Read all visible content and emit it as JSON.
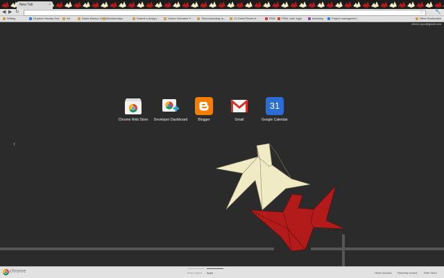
{
  "window": {
    "tab_title": "New Tab",
    "tab_close": "×",
    "back": "◀",
    "forward": "▶",
    "reload": "↻",
    "star": "☆",
    "wrench": "🔧",
    "user_email": "eileen.l.guo@gmail.com"
  },
  "bookmarks": {
    "items": [
      {
        "label": "Writing",
        "color": "#caa23a"
      },
      {
        "label": "Dropbox Nearby Scri...",
        "color": "#2a7de1"
      },
      {
        "label": "Art",
        "color": "#c9a43b"
      },
      {
        "label": "Santa Monica Grant...",
        "color": "#c9a43b"
      },
      {
        "label": "Scholarships",
        "color": "#c9a43b"
      },
      {
        "label": "Submit a design...",
        "color": "#c9a43b"
      },
      {
        "label": "Online Volunteer F...",
        "color": "#c9a43b"
      },
      {
        "label": "Telecommuting Jo...",
        "color": "#c9a43b"
      },
      {
        "label": "10 Great Places fr...",
        "color": "#c9a43b"
      },
      {
        "label": "PDM",
        "color": "#d23a2a"
      },
      {
        "label": "PDM: User login",
        "color": "#d23a2a"
      },
      {
        "label": "elearning",
        "color": "#8e44ad"
      },
      {
        "label": "Project managemen...",
        "color": "#2a7de1"
      }
    ],
    "other_bookmarks": "Other Bookmarks"
  },
  "apps": [
    {
      "name": "Chrome Web Store",
      "icon": "chrome-web-store-icon"
    },
    {
      "name": "Developer Dashboard",
      "icon": "developer-dashboard-icon"
    },
    {
      "name": "Blogger",
      "icon": "blogger-icon",
      "color": "#f57d00"
    },
    {
      "name": "Gmail",
      "icon": "gmail-icon",
      "color": "#d93025"
    },
    {
      "name": "Google Calendar",
      "icon": "google-calendar-icon",
      "color": "#2c6dd5",
      "day": "31"
    }
  ],
  "nav": {
    "prev_arrow": "‹"
  },
  "bottom": {
    "brand": "chrome",
    "most_visited": "Most visited",
    "apps": "Apps",
    "other_devices": "Other devices",
    "recently_closed": "Recently closed",
    "web_store": "Web Store"
  },
  "theme": {
    "background": "#2b2b2b",
    "crane_cream": "#f1ebc5",
    "crane_red": "#b31b1b",
    "line_gray": "#555555"
  }
}
